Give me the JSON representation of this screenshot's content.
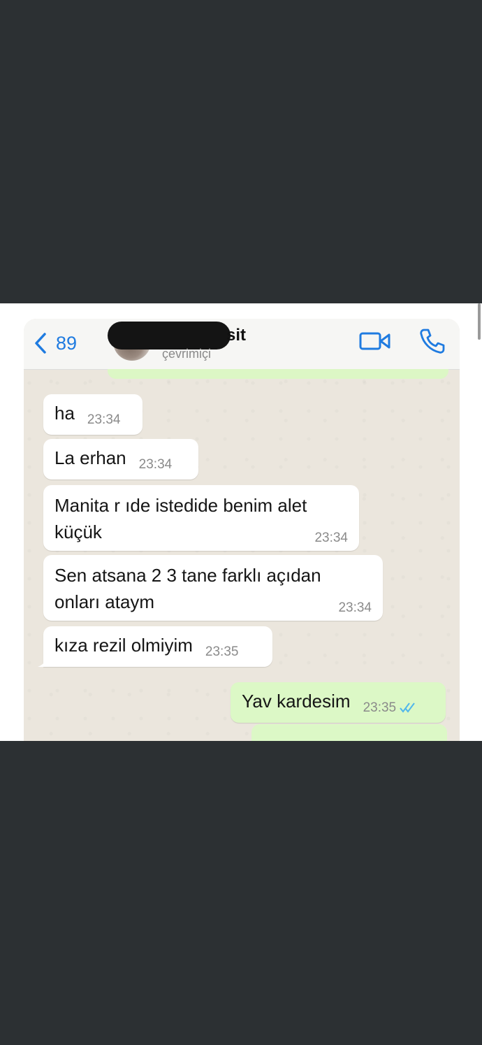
{
  "header": {
    "back_count": "89",
    "contact_name_partial": "sit",
    "status": "çevrimiçi"
  },
  "icons": {
    "back": "chevron-left-icon",
    "video": "video-camera-icon",
    "call": "phone-icon"
  },
  "colors": {
    "accent": "#1f7be0",
    "incoming_bubble": "#ffffff",
    "outgoing_bubble": "#dcf8c6",
    "chat_background": "#ebe6dd",
    "read_ticks": "#4fb6ec"
  },
  "messages": [
    {
      "text": "ha",
      "time": "23:34",
      "direction": "in"
    },
    {
      "text": "La erhan",
      "time": "23:34",
      "direction": "in"
    },
    {
      "text": "Manita r ıde istedide benim alet küçük",
      "time": "23:34",
      "direction": "in"
    },
    {
      "text": "Sen atsana 2 3 tane farklı açıdan onları ataym",
      "time": "23:34",
      "direction": "in"
    },
    {
      "text": "kıza rezil olmiyim",
      "time": "23:35",
      "direction": "in"
    },
    {
      "text": "Yav kardesim",
      "time": "23:35",
      "direction": "out",
      "read": true
    }
  ]
}
